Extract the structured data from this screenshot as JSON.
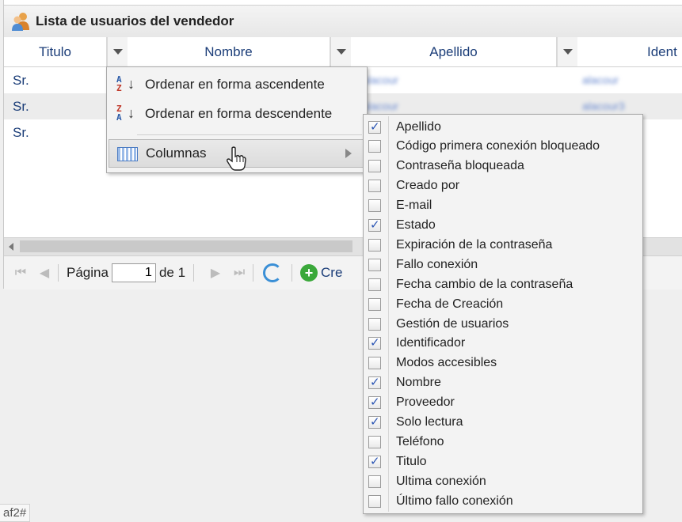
{
  "panel": {
    "title": "Lista de usuarios del vendedor"
  },
  "grid": {
    "columns": [
      "Titulo",
      "Nombre",
      "Apellido",
      "Ident"
    ],
    "rows": [
      {
        "titulo": "Sr.",
        "apellido": "alacour",
        "ident": "alacour"
      },
      {
        "titulo": "Sr.",
        "apellido": "alacour",
        "ident": "alacour3"
      },
      {
        "titulo": "Sr.",
        "apellido": "",
        "ident": ""
      }
    ]
  },
  "paging": {
    "page_label": "Página",
    "page_value": "1",
    "of_label": "de 1",
    "create_label": "Cre"
  },
  "context_menu": {
    "sort_asc": "Ordenar en forma ascendente",
    "sort_desc": "Ordenar en forma descendente",
    "columns": "Columnas"
  },
  "column_menu": [
    {
      "label": "Apellido",
      "checked": true
    },
    {
      "label": "Código primera conexión bloqueado",
      "checked": false
    },
    {
      "label": "Contraseña bloqueada",
      "checked": false
    },
    {
      "label": "Creado por",
      "checked": false
    },
    {
      "label": "E-mail",
      "checked": false
    },
    {
      "label": "Estado",
      "checked": true
    },
    {
      "label": "Expiración de la contraseña",
      "checked": false
    },
    {
      "label": "Fallo conexión",
      "checked": false
    },
    {
      "label": "Fecha cambio de la contraseña",
      "checked": false
    },
    {
      "label": "Fecha de Creación",
      "checked": false
    },
    {
      "label": "Gestión de usuarios",
      "checked": false
    },
    {
      "label": "Identificador",
      "checked": true
    },
    {
      "label": "Modos accesibles",
      "checked": false
    },
    {
      "label": "Nombre",
      "checked": true
    },
    {
      "label": "Proveedor",
      "checked": true
    },
    {
      "label": "Solo lectura",
      "checked": true
    },
    {
      "label": "Teléfono",
      "checked": false
    },
    {
      "label": "Titulo",
      "checked": true
    },
    {
      "label": "Ultima conexión",
      "checked": false
    },
    {
      "label": "Último fallo conexión",
      "checked": false
    }
  ],
  "status_bar": {
    "text": "af2#"
  }
}
